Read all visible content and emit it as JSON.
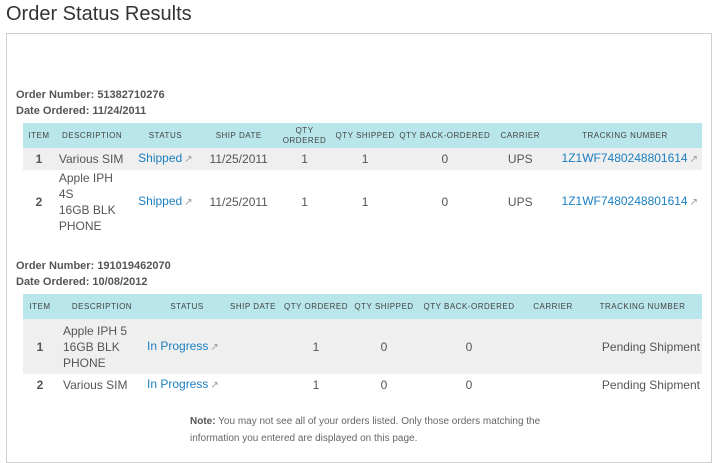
{
  "page": {
    "title": "Order Status Results"
  },
  "labels": {
    "order_number": "Order Number:",
    "date_ordered": "Date Ordered:"
  },
  "headers1": [
    "ITEM",
    "DESCRIPTION",
    "STATUS",
    "SHIP DATE",
    "QTY ORDERED",
    "QTY SHIPPED",
    "QTY BACK-ORDERED",
    "CARRIER",
    "TRACKING NUMBER"
  ],
  "headers2": [
    "ITEM",
    "DESCRIPTION",
    "STATUS",
    "SHIP DATE",
    "QTY ORDERED",
    "QTY SHIPPED",
    "QTY BACK-ORDERED",
    "CARRIER",
    "TRACKING NUMBER"
  ],
  "orders": [
    {
      "order_number": "51382710276",
      "date_ordered": "11/24/2011",
      "rows": [
        {
          "item": "1",
          "desc": [
            "Various SIM"
          ],
          "status": "Shipped",
          "ship_date": "11/25/2011",
          "qty_ordered": "1",
          "qty_shipped": "1",
          "qty_back": "0",
          "carrier": "UPS",
          "tracking": "1Z1WF7480248801614"
        },
        {
          "item": "2",
          "desc": [
            "Apple IPH 4S",
            "16GB BLK",
            "PHONE"
          ],
          "status": "Shipped",
          "ship_date": "11/25/2011",
          "qty_ordered": "1",
          "qty_shipped": "1",
          "qty_back": "0",
          "carrier": "UPS",
          "tracking": "1Z1WF7480248801614"
        }
      ]
    },
    {
      "order_number": "191019462070",
      "date_ordered": "10/08/2012",
      "rows": [
        {
          "item": "1",
          "desc": [
            "Apple IPH 5",
            "16GB BLK",
            "PHONE"
          ],
          "status": "In Progress",
          "ship_date": "",
          "qty_ordered": "1",
          "qty_shipped": "0",
          "qty_back": "0",
          "carrier": "",
          "tracking": "Pending Shipment"
        },
        {
          "item": "2",
          "desc": [
            "Various SIM"
          ],
          "status": "In Progress",
          "ship_date": "",
          "qty_ordered": "1",
          "qty_shipped": "0",
          "qty_back": "0",
          "carrier": "",
          "tracking": "Pending Shipment"
        }
      ]
    }
  ],
  "note": {
    "label": "Note:",
    "text": " You may not see all of your orders listed. Only those orders matching the information you entered are displayed on this page."
  },
  "icons": {
    "external_link": "external-link-icon"
  },
  "colors": {
    "header_bg": "#b8e6ea",
    "link": "#1a7fc0",
    "row_alt": "#efefef"
  }
}
